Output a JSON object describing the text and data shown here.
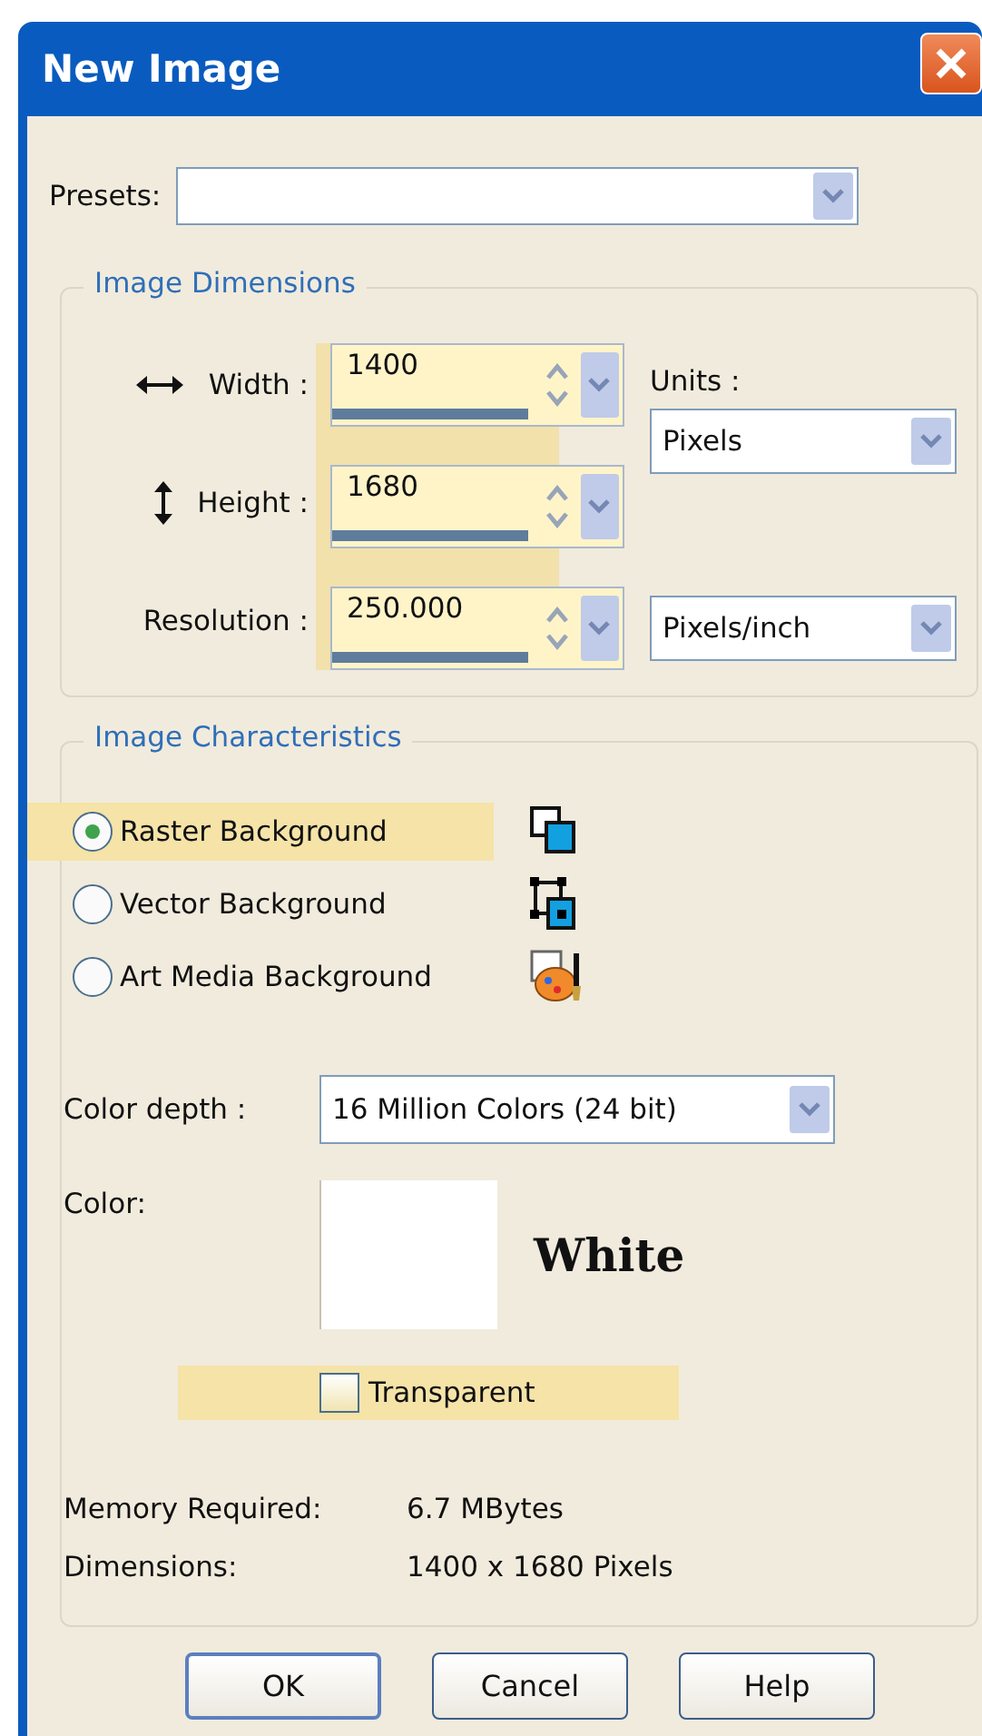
{
  "window": {
    "title": "New Image"
  },
  "presets": {
    "label": "Presets:"
  },
  "image_dimensions": {
    "legend": "Image Dimensions",
    "fields": [
      {
        "kind": "width",
        "label": "Width :",
        "value": "1400"
      },
      {
        "kind": "height",
        "label": "Height :",
        "value": "1680"
      },
      {
        "kind": "resolution",
        "label": "Resolution :",
        "value": "250.000"
      }
    ],
    "units_label": "Units :",
    "units": "Pixels",
    "resolution_units": "Pixels/inch"
  },
  "image_characteristics": {
    "legend": "Image Characteristics",
    "backgrounds": [
      {
        "kind": "raster",
        "label": "Raster Background",
        "selected": true
      },
      {
        "kind": "vector",
        "label": "Vector Background",
        "selected": false
      },
      {
        "kind": "art",
        "label": "Art Media Background",
        "selected": false
      }
    ],
    "color_depth_label": "Color depth :",
    "color_depth": "16 Million Colors (24 bit)",
    "color_label": "Color:",
    "color_name": "White",
    "color": "#ffffff",
    "transparent": {
      "label": "Transparent",
      "checked": false
    },
    "info": [
      {
        "label": "Memory Required:",
        "value": "6.7 MBytes"
      },
      {
        "label": "Dimensions:",
        "value": "1400 x 1680 Pixels"
      }
    ]
  },
  "buttons": [
    {
      "label": "OK",
      "default": true
    },
    {
      "label": "Cancel",
      "default": false
    },
    {
      "label": "Help",
      "default": false
    }
  ]
}
